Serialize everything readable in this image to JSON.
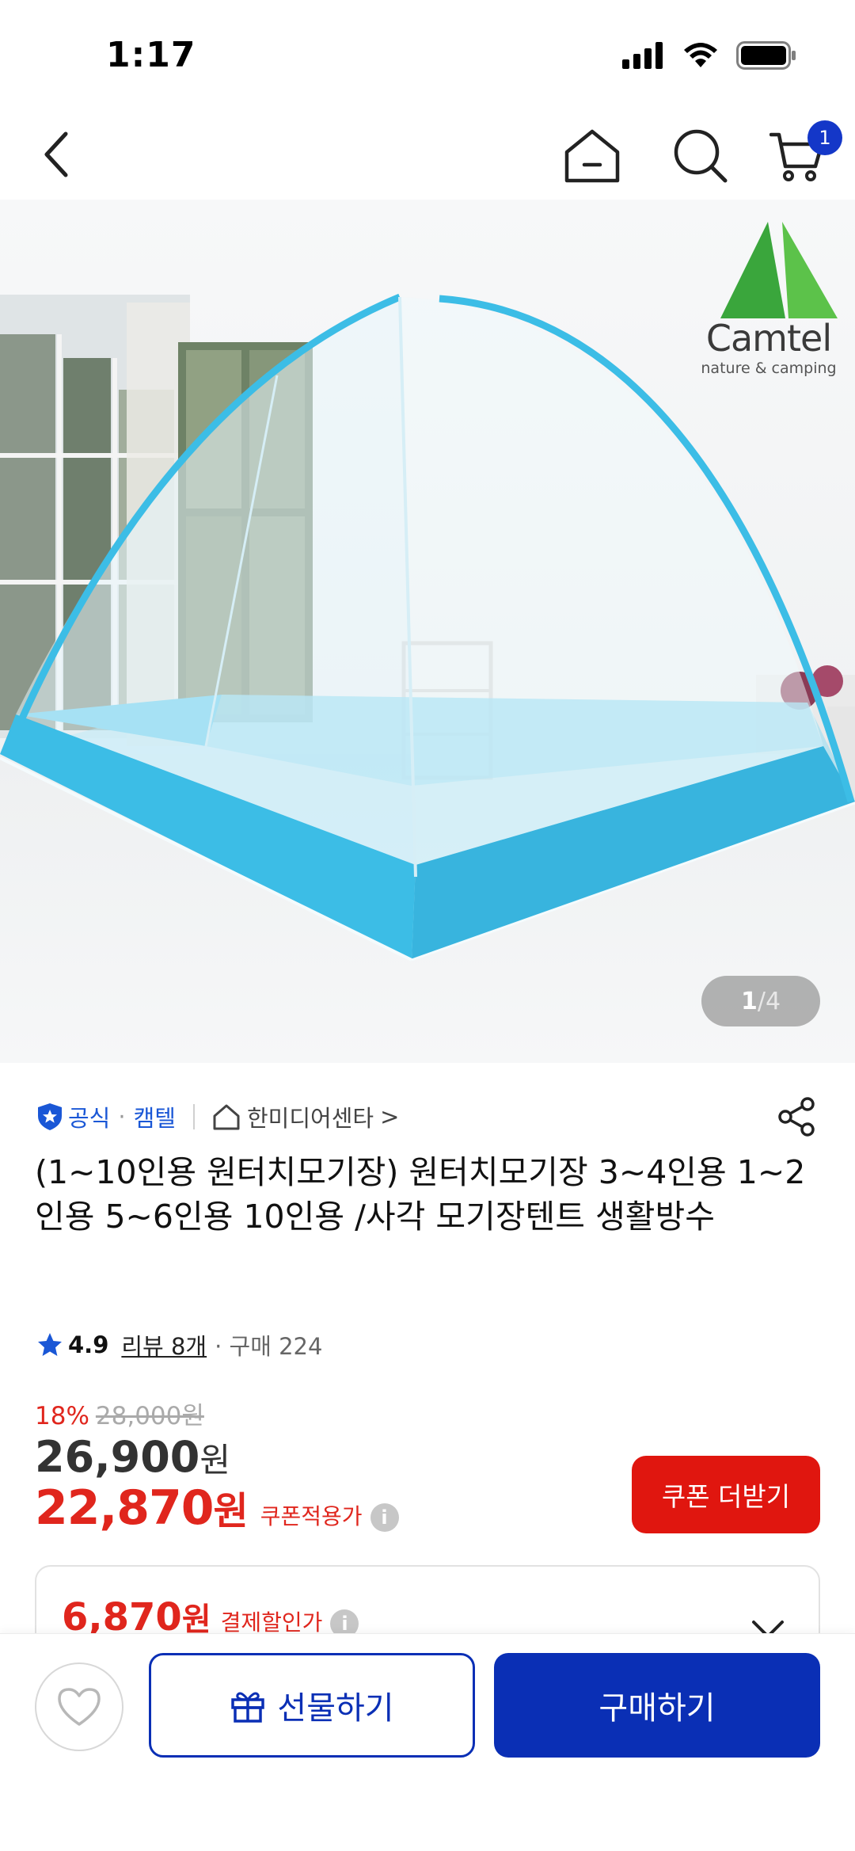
{
  "status_bar": {
    "time": "1:17"
  },
  "nav": {
    "cart_count": "1"
  },
  "hero": {
    "brand_logo_name": "Camtel",
    "brand_logo_tagline": "nature & camping",
    "image_index": "1",
    "image_separator": "/",
    "image_total": "4"
  },
  "seller": {
    "official_label": "공식",
    "separator": "·",
    "brand": "캠텔",
    "shop_name": "한미디어센타",
    "shop_chevron": ">"
  },
  "product": {
    "title": "(1~10인용 원터치모기장) 원터치모기장 3~4인용 1~2인용 5~6인용 10인용 /사각 모기장텐트 생활방수",
    "rating": "4.9",
    "review_label": "리뷰 8개",
    "purchase_label": "· 구매 224"
  },
  "price": {
    "discount_rate": "18%",
    "original_price": "28,000원",
    "sale_amount": "26,900",
    "sale_unit": "원",
    "coupon_amount": "22,870",
    "coupon_unit": "원",
    "coupon_label": "쿠폰적용가",
    "coupon_button": "쿠폰 더받기",
    "info_glyph": "i"
  },
  "payment": {
    "amount": "6,870",
    "unit": "원",
    "label": "결제할인가",
    "info_glyph": "i"
  },
  "bottom_bar": {
    "gift_label": "선물하기",
    "buy_label": "구매하기"
  },
  "colors": {
    "accent_blue": "#0a2fb5",
    "sale_red": "#e0261d",
    "coupon_button_red": "#e0160f",
    "official_blue": "#1a57d6",
    "tent_cyan": "#3cbde6"
  },
  "icons": {
    "back": "chevron-left-icon",
    "home": "home-icon",
    "search": "search-icon",
    "cart": "cart-icon",
    "official": "shield-check-icon",
    "shop": "house-icon",
    "share": "share-icon",
    "star": "star-icon",
    "info": "info-icon",
    "chevron_down": "chevron-down-icon",
    "heart": "heart-icon",
    "gift": "gift-icon"
  }
}
